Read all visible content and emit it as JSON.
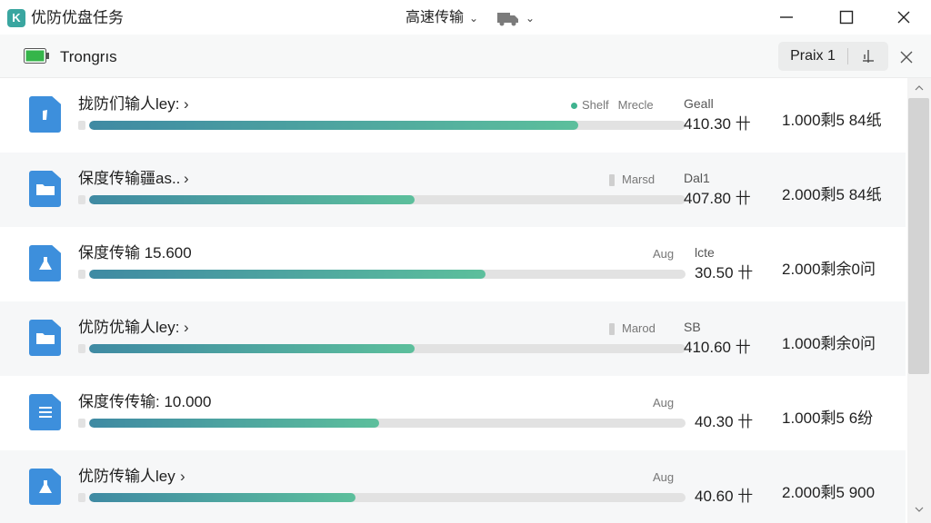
{
  "app": {
    "logo_letter": "K",
    "title": "优防优盘任务",
    "speed_menu_label": "高速传输"
  },
  "toolbar": {
    "title": "Trongrıs",
    "filter_label": "Praix 1"
  },
  "colors": {
    "progress_start": "#3f8aa3",
    "progress_end": "#5cbf9c",
    "file_icon": "#3d8fdc",
    "status_dot": "#3fb38f"
  },
  "tasks": [
    {
      "name": "拢防们输人ley:",
      "icon": "document-icon",
      "progress": 0.82,
      "tag1": "Shelf",
      "tag2": "Mrecle",
      "tag_style": "dot",
      "speed_label": "Geall",
      "speed": "410.30 卄",
      "remaining": "1.000剩5 84纸"
    },
    {
      "name": "保度传输疆as..",
      "icon": "folder-icon",
      "progress": 0.545,
      "tag1": "",
      "tag2": "Marsd",
      "tag_style": "mini",
      "speed_label": "Dal1",
      "speed": "407.80 卄",
      "remaining": "2.000剩5 84纸"
    },
    {
      "name": "保度传输 15.600",
      "icon": "flask-icon",
      "progress": 0.664,
      "tag1": "",
      "tag2": "Aug",
      "tag_style": "none",
      "speed_label": "lcte",
      "speed": "30.50 卄",
      "remaining": "2.000剩余0问"
    },
    {
      "name": "优防优输人ley:",
      "icon": "folder-icon",
      "progress": 0.545,
      "tag1": "",
      "tag2": "Marod",
      "tag_style": "mini",
      "speed_label": "SB",
      "speed": "410.60 卄",
      "remaining": "1.000剩余0问"
    },
    {
      "name": "保度传传输: 10.000",
      "icon": "list-icon",
      "progress": 0.487,
      "tag1": "",
      "tag2": "Aug",
      "tag_style": "none",
      "speed_label": "",
      "speed": "40.30 卄",
      "remaining": "1.000剩5 6纷"
    },
    {
      "name": "优防传输人ley",
      "icon": "flask-icon",
      "progress": 0.447,
      "tag1": "",
      "tag2": "Aug",
      "tag_style": "none",
      "speed_label": "",
      "speed": "40.60 卄",
      "remaining": "2.000剩5 900"
    }
  ]
}
